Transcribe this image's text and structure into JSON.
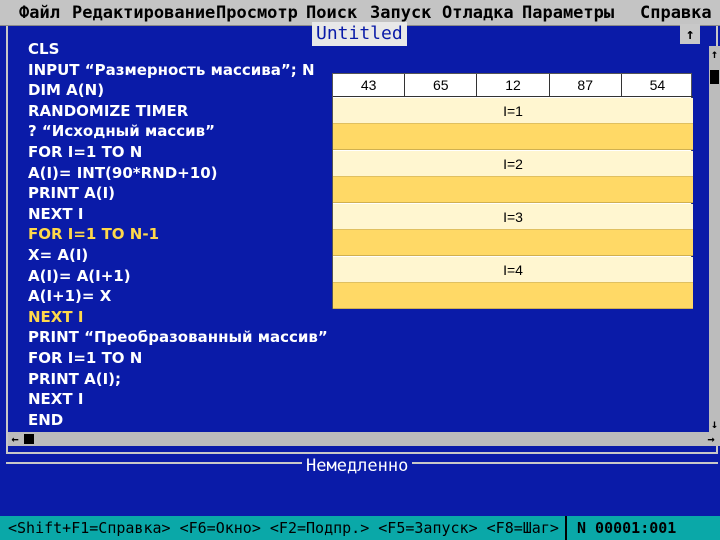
{
  "menu": {
    "items": [
      "Файл",
      "Редактирование",
      "Просмотр",
      "Поиск",
      "Запуск",
      "Отладка",
      "Параметры",
      "Справка"
    ]
  },
  "editor": {
    "title": "Untitled",
    "maximize_glyph": "↑",
    "code_lines": [
      {
        "text": "CLS",
        "highlight": false
      },
      {
        "text": "INPUT “Размерность массива”; N",
        "highlight": false
      },
      {
        "text": "DIM A(N)",
        "highlight": false
      },
      {
        "text": "RANDOMIZE TIMER",
        "highlight": false
      },
      {
        "text": "? “Исходный массив”",
        "highlight": false
      },
      {
        "text": "FOR  I=1 TO N",
        "highlight": false
      },
      {
        "text": "A(I)= INT(90*RND+10)",
        "highlight": false
      },
      {
        "text": "PRINT A(I)",
        "highlight": false
      },
      {
        "text": "NEXT I",
        "highlight": false
      },
      {
        "text": "FOR  I=1 TO N-1",
        "highlight": true
      },
      {
        "text": "X= A(I)",
        "highlight": false
      },
      {
        "text": "A(I)= A(I+1)",
        "highlight": false
      },
      {
        "text": "A(I+1)= X",
        "highlight": false
      },
      {
        "text": "NEXT I",
        "highlight": true
      },
      {
        "text": "PRINT “Преобразованный массив”",
        "highlight": false
      },
      {
        "text": "FOR  I=1 TO N",
        "highlight": false
      },
      {
        "text": "PRINT A(I);",
        "highlight": false
      },
      {
        "text": "NEXT I",
        "highlight": false
      },
      {
        "text": "END",
        "highlight": false
      }
    ]
  },
  "overlay": {
    "array_values": [
      "43",
      "65",
      "12",
      "87",
      "54"
    ],
    "iterations": [
      "I=1",
      "I=2",
      "I=3",
      "I=4"
    ]
  },
  "scroll": {
    "up": "↑",
    "down": "↓",
    "left": "←",
    "right": "→"
  },
  "immediate": {
    "title": "Немедленно"
  },
  "status": {
    "keys": "<Shift+F1=Справка> <F6=Окно> <F2=Подпр.> <F5=Запуск> <F8=Шаг>",
    "position": "N 00001:001"
  },
  "colors": {
    "background": "#0a1ba8",
    "menu": "#c4c4c4",
    "highlight_code": "#ffd84a",
    "status": "#0aa8a8",
    "overlay_label": "#fff6d0",
    "overlay_band": "#ffd966"
  }
}
